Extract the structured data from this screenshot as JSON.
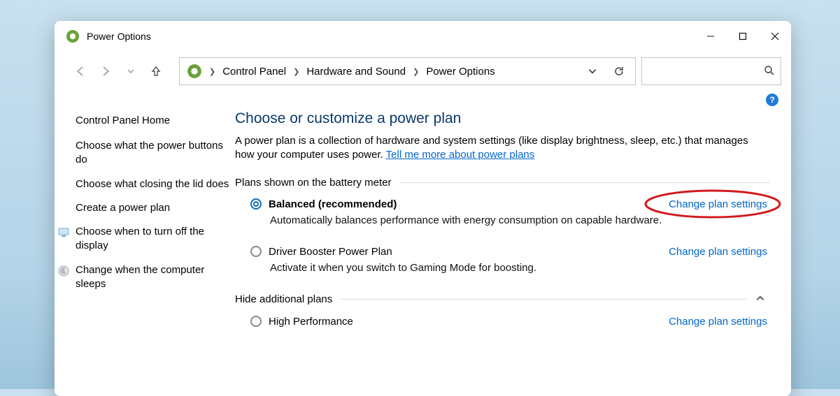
{
  "window": {
    "title": "Power Options"
  },
  "breadcrumb": {
    "items": [
      "Control Panel",
      "Hardware and Sound",
      "Power Options"
    ]
  },
  "sidebar": {
    "home": "Control Panel Home",
    "items": [
      {
        "label": "Choose what the power buttons do",
        "iconless": true
      },
      {
        "label": "Choose what closing the lid does",
        "iconless": true
      },
      {
        "label": "Create a power plan",
        "iconless": true
      },
      {
        "label": "Choose when to turn off the display",
        "icon": "display-icon"
      },
      {
        "label": "Change when the computer sleeps",
        "icon": "moon-icon"
      }
    ]
  },
  "main": {
    "title": "Choose or customize a power plan",
    "intro": "A power plan is a collection of hardware and system settings (like display brightness, sleep, etc.) that manages how your computer uses power. ",
    "intro_link": "Tell me more about power plans",
    "section1_label": "Plans shown on the battery meter",
    "plans": [
      {
        "selected": true,
        "name": "Balanced (recommended)",
        "desc": "Automatically balances performance with energy consumption on capable hardware.",
        "change": "Change plan settings",
        "highlight": true
      },
      {
        "selected": false,
        "name": "Driver Booster Power Plan",
        "desc": "Activate it when you switch to Gaming Mode for boosting.",
        "change": "Change plan settings"
      }
    ],
    "section2_label": "Hide additional plans",
    "more_plans": [
      {
        "selected": false,
        "name": "High Performance",
        "change": "Change plan settings"
      }
    ]
  },
  "help": "?"
}
